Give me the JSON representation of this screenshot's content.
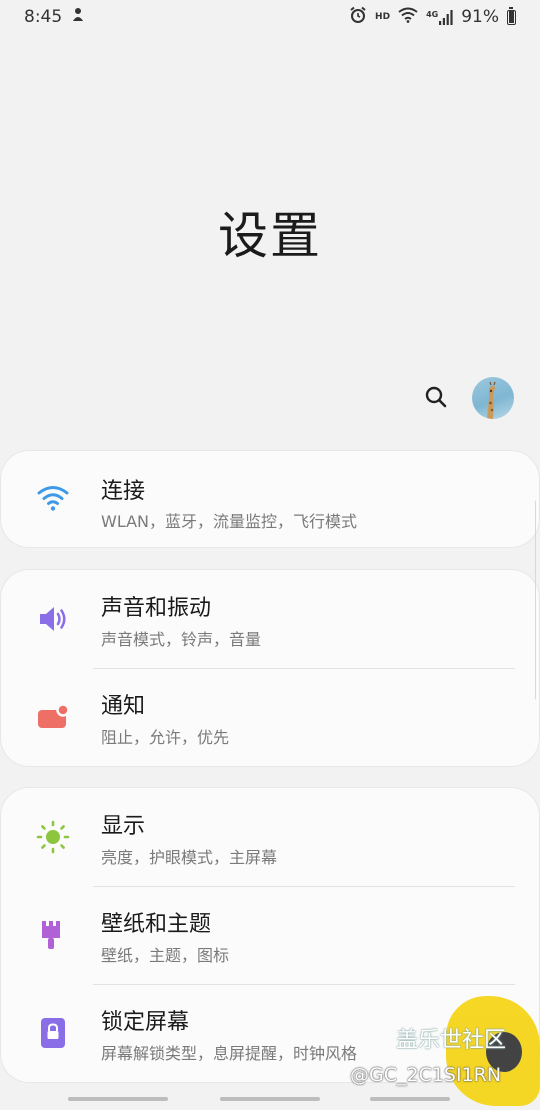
{
  "status_bar": {
    "time": "8:45",
    "hd": "HD",
    "network": "4G",
    "battery": "91%",
    "battery_level": 0.91
  },
  "page": {
    "title": "设置"
  },
  "groups": [
    {
      "items": [
        {
          "title": "连接",
          "subtitle": "WLAN，蓝牙，流量监控，飞行模式",
          "icon": "wifi-icon",
          "color": "#3d9ae8"
        }
      ]
    },
    {
      "items": [
        {
          "title": "声音和振动",
          "subtitle": "声音模式，铃声，音量",
          "icon": "speaker-icon",
          "color": "#8a6ee8"
        },
        {
          "title": "通知",
          "subtitle": "阻止，允许，优先",
          "icon": "notification-icon",
          "color": "#ee6f66"
        }
      ]
    },
    {
      "items": [
        {
          "title": "显示",
          "subtitle": "亮度，护眼模式，主屏幕",
          "icon": "brightness-icon",
          "color": "#8cc63f"
        },
        {
          "title": "壁纸和主题",
          "subtitle": "壁纸，主题，图标",
          "icon": "brush-icon",
          "color": "#b061d6"
        },
        {
          "title": "锁定屏幕",
          "subtitle": "屏幕解锁类型，息屏提醒，时钟风格",
          "icon": "lock-icon",
          "color": "#8a6ee8"
        }
      ]
    }
  ],
  "watermark": {
    "line1": "盖乐世社区",
    "line2": "@GC_2C1SI1RN"
  }
}
